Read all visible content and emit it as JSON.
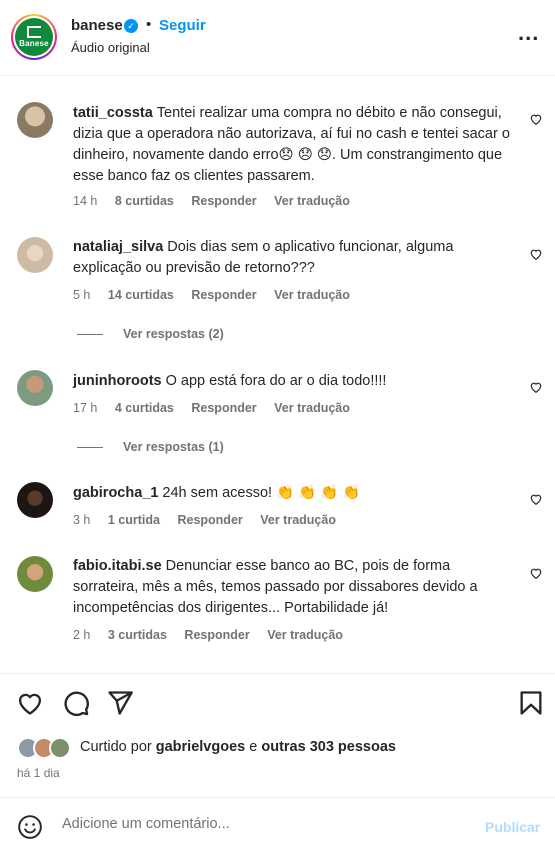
{
  "header": {
    "logo_text": "Banese",
    "username": "banese",
    "verified_mark": "✓",
    "separator": "•",
    "follow_label": "Seguir",
    "subtitle": "Áudio original",
    "more_label": "..."
  },
  "comments": [
    {
      "username": "tatii_cossta",
      "text": "Tentei realizar uma compra no débito e não consegui, dizia que a operadora não autorizava, aí fui no cash e tentei sacar o dinheiro, novamente dando erro😞 😞 😞. Um constrangimento que esse banco faz os clientes passarem.",
      "time": "14 h",
      "likes": "8 curtidas",
      "reply": "Responder",
      "translate": "Ver tradução",
      "avatar_color": "#b9a48a"
    },
    {
      "username": "nataliaj_silva",
      "text": "Dois dias sem o aplicativo funcionar, alguma explicação ou previsão de retorno???",
      "time": "5 h",
      "likes": "14 curtidas",
      "reply": "Responder",
      "translate": "Ver tradução",
      "replies_label": "Ver respostas (2)",
      "avatar_color": "#d8c8b4"
    },
    {
      "username": "juninhoroots",
      "text": "O app está fora do ar o dia todo!!!!",
      "time": "17 h",
      "likes": "4 curtidas",
      "reply": "Responder",
      "translate": "Ver tradução",
      "replies_label": "Ver respostas (1)",
      "avatar_color": "#8aa28c"
    },
    {
      "username": "gabirocha_1",
      "text": "24h sem acesso! 👏 👏 👏 👏",
      "time": "3 h",
      "likes": "1 curtida",
      "reply": "Responder",
      "translate": "Ver tradução",
      "avatar_color": "#2b1f1a"
    },
    {
      "username": "fabio.itabi.se",
      "text": "Denunciar esse banco ao BC, pois de forma sorrateira, mês a mês, temos passado por dissabores devido a incompetências dos dirigentes... Portabilidade já!",
      "time": "2 h",
      "likes": "3 curtidas",
      "reply": "Responder",
      "translate": "Ver tradução",
      "avatar_color": "#c2a36a"
    }
  ],
  "footer": {
    "liked_prefix": "Curtido por",
    "liked_user": "gabrielvgoes",
    "liked_conj": "e",
    "liked_others": "outras 303 pessoas",
    "time_ago": "há 1 dia",
    "comment_placeholder": "Adicione um comentário...",
    "publish_label": "Publicar"
  },
  "colors": {
    "accent": "#0095f6",
    "brand_green": "#0f8a3c",
    "muted": "#737373",
    "publish_disabled": "#b3dbff"
  },
  "icons": [
    "verified-icon",
    "more-icon",
    "heart-icon",
    "comment-icon",
    "share-icon",
    "bookmark-icon",
    "emoji-icon"
  ]
}
